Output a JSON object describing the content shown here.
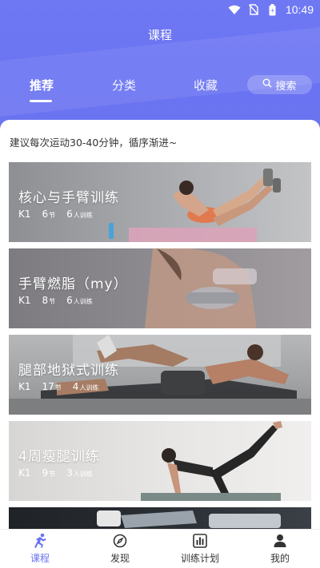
{
  "status_bar": {
    "time": "10:49"
  },
  "header": {
    "title": "课程"
  },
  "tabs": [
    {
      "label": "推荐",
      "active": true
    },
    {
      "label": "分类",
      "active": false
    },
    {
      "label": "收藏",
      "active": false
    }
  ],
  "search": {
    "label": "搜索"
  },
  "tip": "建议每次运动30-40分钟，循序渐进~",
  "courses": [
    {
      "title": "核心与手臂训练",
      "level": "K1",
      "sessions": "6",
      "sessions_unit": "节",
      "trainees": "6",
      "trainees_unit": "人训练"
    },
    {
      "title": "手臂燃脂（my）",
      "level": "K1",
      "sessions": "8",
      "sessions_unit": "节",
      "trainees": "6",
      "trainees_unit": "人训练"
    },
    {
      "title": "腿部地狱式训练",
      "level": "K1",
      "sessions": "17",
      "sessions_unit": "节",
      "trainees": "4",
      "trainees_unit": "人训练"
    },
    {
      "title": "4周瘦腿训练",
      "level": "K1",
      "sessions": "9",
      "sessions_unit": "节",
      "trainees": "3",
      "trainees_unit": "人训练"
    }
  ],
  "bottom_nav": [
    {
      "label": "课程",
      "icon": "runner-icon",
      "active": true
    },
    {
      "label": "发现",
      "icon": "compass-icon",
      "active": false
    },
    {
      "label": "训练计划",
      "icon": "bar-chart-icon",
      "active": false
    },
    {
      "label": "我的",
      "icon": "person-icon",
      "active": false
    }
  ],
  "colors": {
    "accent": "#6a73f2",
    "header_bg": "#6f78f3"
  }
}
